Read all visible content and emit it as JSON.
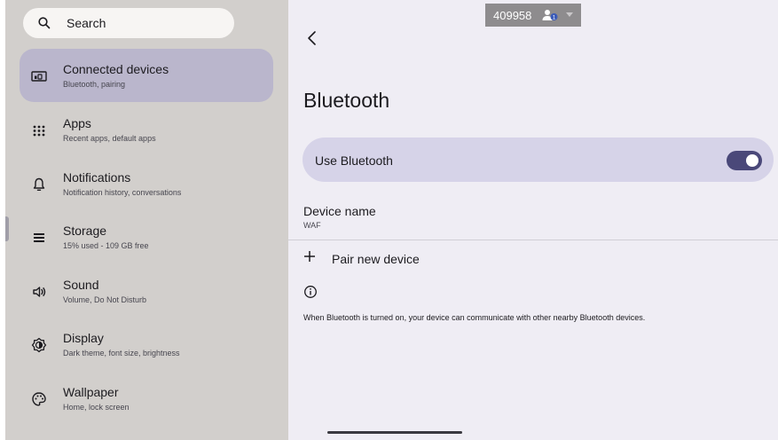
{
  "search": {
    "label": "Search",
    "icon": "search-icon"
  },
  "sidebar": {
    "items": [
      {
        "title": "Connected devices",
        "subtitle": "Bluetooth, pairing",
        "icon": "connected-devices-icon",
        "active": true
      },
      {
        "title": "Apps",
        "subtitle": "Recent apps, default apps",
        "icon": "apps-grid-icon",
        "active": false
      },
      {
        "title": "Notifications",
        "subtitle": "Notification history, conversations",
        "icon": "bell-icon",
        "active": false
      },
      {
        "title": "Storage",
        "subtitle": "15% used - 109 GB free",
        "icon": "storage-icon",
        "active": false
      },
      {
        "title": "Sound",
        "subtitle": "Volume, Do Not Disturb",
        "icon": "volume-icon",
        "active": false
      },
      {
        "title": "Display",
        "subtitle": "Dark theme, font size, brightness",
        "icon": "brightness-icon",
        "active": false
      },
      {
        "title": "Wallpaper",
        "subtitle": "Home, lock screen",
        "icon": "palette-icon",
        "active": false
      }
    ]
  },
  "header": {
    "user_id": "409958",
    "user_icon": "user-account-icon"
  },
  "main": {
    "title": "Bluetooth",
    "use_bluetooth_label": "Use Bluetooth",
    "use_bluetooth_on": true,
    "device_name_label": "Device name",
    "device_name_value": "WAF",
    "pair_new_device_label": "Pair new device",
    "info_text": "When Bluetooth is turned on, your device can communicate with other nearby Bluetooth devices."
  },
  "colors": {
    "sidebar_bg": "#d2cfcc",
    "active_item": "#bab6cc",
    "content_bg": "#efedf4",
    "toggle_card": "#d6d3e8",
    "switch_on": "#4a4879"
  }
}
